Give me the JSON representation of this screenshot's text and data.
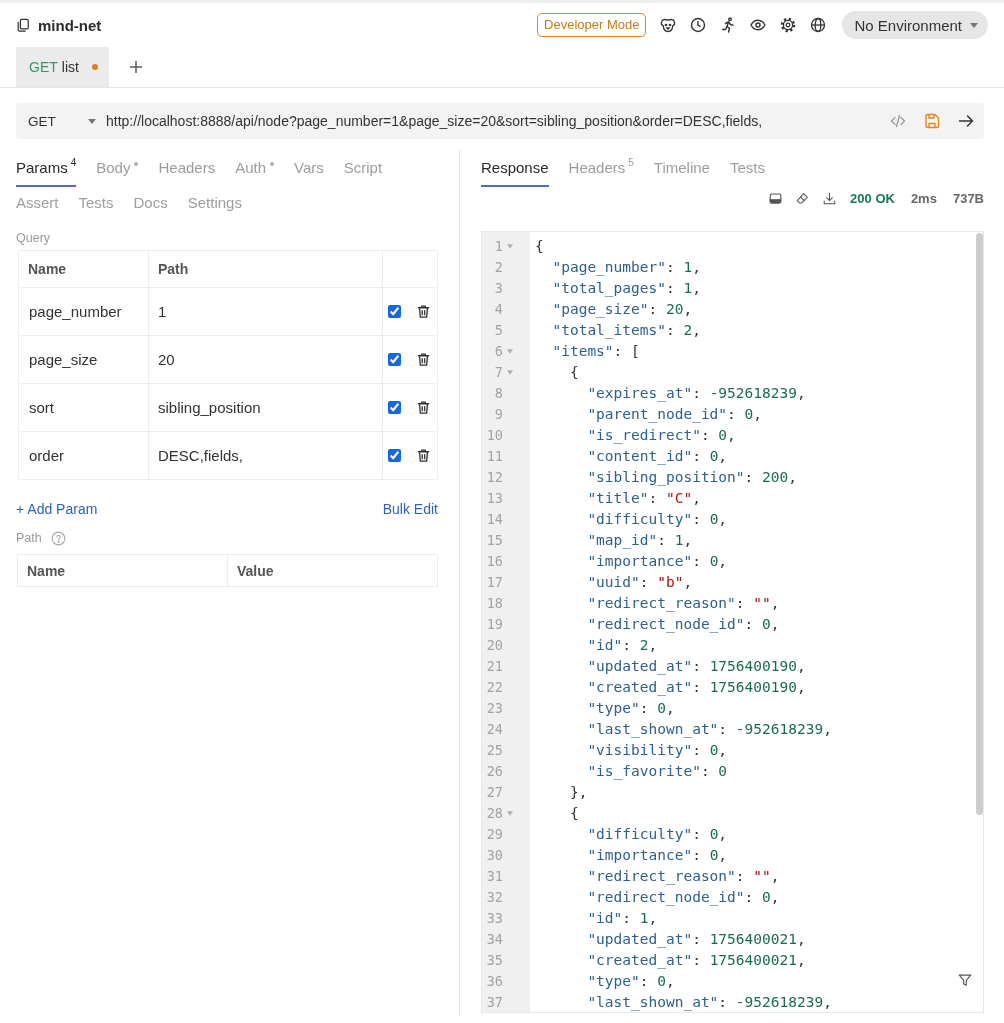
{
  "workspace": {
    "title": "mind-net"
  },
  "toolbar": {
    "mode_badge": "Developer Mode",
    "environment": "No Environment"
  },
  "request_tabs": [
    {
      "method": "GET",
      "color": "#2e9a68",
      "name": "list",
      "selected": true,
      "unsaved": true
    }
  ],
  "url_bar": {
    "method": "GET",
    "url": "http://localhost:8888/api/node?page_number=1&page_size=20&sort=sibling_position&order=DESC,fields,"
  },
  "request_pane": {
    "tabs": [
      {
        "label": "Params",
        "count": "4",
        "modified": false,
        "selected": true
      },
      {
        "label": "Body",
        "modified": true,
        "selected": false
      },
      {
        "label": "Headers",
        "modified": false,
        "selected": false
      },
      {
        "label": "Auth",
        "modified": true,
        "selected": false
      },
      {
        "label": "Vars",
        "modified": false,
        "selected": false
      },
      {
        "label": "Script",
        "modified": false,
        "selected": false
      },
      {
        "label": "Assert",
        "modified": false,
        "selected": false
      },
      {
        "label": "Tests",
        "modified": false,
        "selected": false
      },
      {
        "label": "Docs",
        "modified": false,
        "selected": false
      },
      {
        "label": "Settings",
        "modified": false,
        "selected": false
      }
    ],
    "query": {
      "label": "Query",
      "columns": [
        "Name",
        "Path"
      ],
      "rows": [
        {
          "name": "page_number",
          "value": "1",
          "enabled": true
        },
        {
          "name": "page_size",
          "value": "20",
          "enabled": true
        },
        {
          "name": "sort",
          "value": "sibling_position",
          "enabled": true
        },
        {
          "name": "order",
          "value": "DESC,fields,",
          "enabled": true
        }
      ],
      "add_button": "+ Add Param",
      "bulk_edit": "Bulk Edit"
    },
    "path": {
      "label": "Path",
      "columns": [
        "Name",
        "Value"
      ]
    }
  },
  "response_pane": {
    "tabs": [
      {
        "label": "Response",
        "selected": true
      },
      {
        "label": "Headers",
        "count": "5",
        "selected": false
      },
      {
        "label": "Timeline",
        "selected": false
      },
      {
        "label": "Tests",
        "selected": false
      }
    ],
    "status": "200 OK",
    "time": "2ms",
    "size": "737B",
    "lines": [
      {
        "number": "1",
        "foldable": true,
        "text": "{"
      },
      {
        "number": "2",
        "foldable": false,
        "text": "  \"page_number\": 1,"
      },
      {
        "number": "3",
        "foldable": false,
        "text": "  \"total_pages\": 1,"
      },
      {
        "number": "4",
        "foldable": false,
        "text": "  \"page_size\": 20,"
      },
      {
        "number": "5",
        "foldable": false,
        "text": "  \"total_items\": 2,"
      },
      {
        "number": "6",
        "foldable": true,
        "text": "  \"items\": ["
      },
      {
        "number": "7",
        "foldable": true,
        "text": "    {"
      },
      {
        "number": "8",
        "foldable": false,
        "text": "      \"expires_at\": -952618239,"
      },
      {
        "number": "9",
        "foldable": false,
        "text": "      \"parent_node_id\": 0,"
      },
      {
        "number": "10",
        "foldable": false,
        "text": "      \"is_redirect\": 0,"
      },
      {
        "number": "11",
        "foldable": false,
        "text": "      \"content_id\": 0,"
      },
      {
        "number": "12",
        "foldable": false,
        "text": "      \"sibling_position\": 200,"
      },
      {
        "number": "13",
        "foldable": false,
        "text": "      \"title\": \"C\","
      },
      {
        "number": "14",
        "foldable": false,
        "text": "      \"difficulty\": 0,"
      },
      {
        "number": "15",
        "foldable": false,
        "text": "      \"map_id\": 1,"
      },
      {
        "number": "16",
        "foldable": false,
        "text": "      \"importance\": 0,"
      },
      {
        "number": "17",
        "foldable": false,
        "text": "      \"uuid\": \"b\","
      },
      {
        "number": "18",
        "foldable": false,
        "text": "      \"redirect_reason\": \"\","
      },
      {
        "number": "19",
        "foldable": false,
        "text": "      \"redirect_node_id\": 0,"
      },
      {
        "number": "20",
        "foldable": false,
        "text": "      \"id\": 2,"
      },
      {
        "number": "21",
        "foldable": false,
        "text": "      \"updated_at\": 1756400190,"
      },
      {
        "number": "22",
        "foldable": false,
        "text": "      \"created_at\": 1756400190,"
      },
      {
        "number": "23",
        "foldable": false,
        "text": "      \"type\": 0,"
      },
      {
        "number": "24",
        "foldable": false,
        "text": "      \"last_shown_at\": -952618239,"
      },
      {
        "number": "25",
        "foldable": false,
        "text": "      \"visibility\": 0,"
      },
      {
        "number": "26",
        "foldable": false,
        "text": "      \"is_favorite\": 0"
      },
      {
        "number": "27",
        "foldable": false,
        "text": "    },"
      },
      {
        "number": "28",
        "foldable": true,
        "text": "    {"
      },
      {
        "number": "29",
        "foldable": false,
        "text": "      \"difficulty\": 0,"
      },
      {
        "number": "30",
        "foldable": false,
        "text": "      \"importance\": 0,"
      },
      {
        "number": "31",
        "foldable": false,
        "text": "      \"redirect_reason\": \"\","
      },
      {
        "number": "32",
        "foldable": false,
        "text": "      \"redirect_node_id\": 0,"
      },
      {
        "number": "33",
        "foldable": false,
        "text": "      \"id\": 1,"
      },
      {
        "number": "34",
        "foldable": false,
        "text": "      \"updated_at\": 1756400021,"
      },
      {
        "number": "35",
        "foldable": false,
        "text": "      \"created_at\": 1756400021,"
      },
      {
        "number": "36",
        "foldable": false,
        "text": "      \"type\": 0,"
      },
      {
        "number": "37",
        "foldable": false,
        "text": "      \"last_shown_at\": -952618239,"
      }
    ]
  }
}
